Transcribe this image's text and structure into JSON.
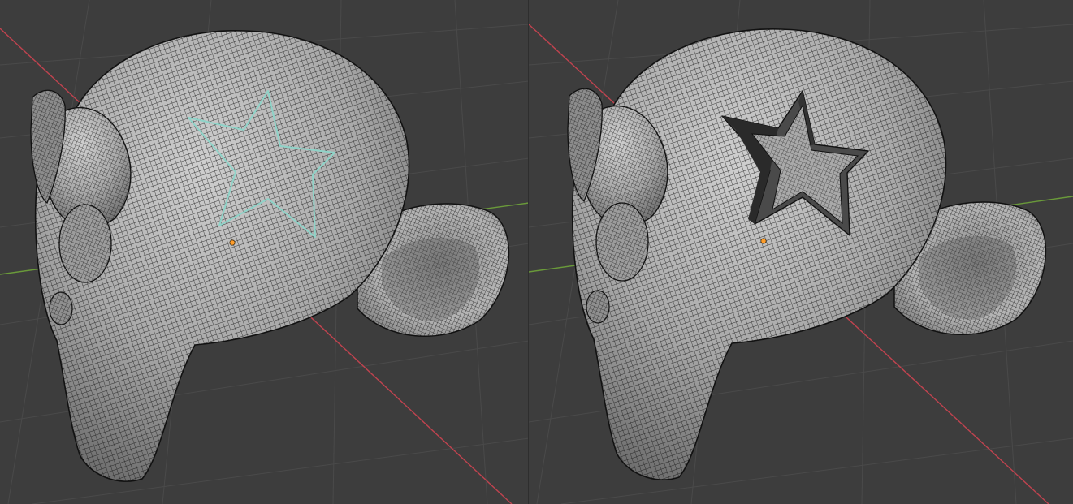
{
  "viewports": [
    {
      "id": "left",
      "title": "",
      "state": "cutter-outline",
      "knife_mode": "project"
    },
    {
      "id": "right",
      "title": "",
      "state": "cut-applied",
      "knife_mode": "project"
    }
  ],
  "colors": {
    "background": "#3d3d3d",
    "grid": "#4a4a4a",
    "axis_x": "#c0434f",
    "axis_y": "#6a9a3a",
    "mesh": "#a8a8a8",
    "wire": "#141414",
    "cutter_outline": "#8fd3c8",
    "origin": "#ff9d2a"
  },
  "icons": [
    "origin-point-icon"
  ]
}
